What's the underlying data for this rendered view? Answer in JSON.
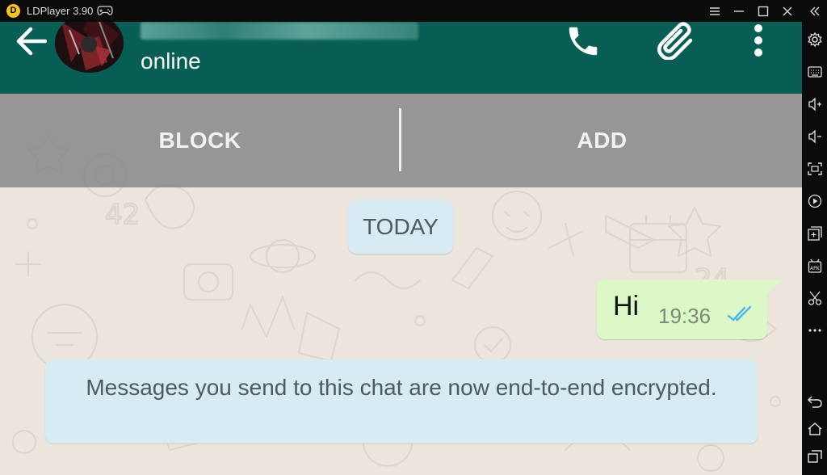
{
  "window": {
    "title": "LDPlayer 3.90",
    "logo_letter": "D"
  },
  "titlebar_buttons": [
    "menu-icon",
    "minimize-icon",
    "maximize-icon",
    "close-icon",
    "collapse-sidebar-icon"
  ],
  "sidebar": [
    "settings-icon",
    "keyboard-icon",
    "volume-up-icon",
    "volume-down-icon",
    "fullscreen-icon",
    "record-icon",
    "add-window-icon",
    "apk-install-icon",
    "scissors-icon",
    "more-icon",
    "back-nav-icon",
    "home-nav-icon",
    "recent-apps-icon"
  ],
  "chat": {
    "contact_status": "online",
    "header_icons": [
      "back-arrow-icon",
      "phone-icon",
      "paperclip-icon",
      "kebab-menu-icon"
    ],
    "actions": {
      "block_label": "BLOCK",
      "add_label": "ADD"
    },
    "date_chip": "TODAY",
    "messages": [
      {
        "text": "Hi",
        "time": "19:36",
        "status_icon": "double-check-icon"
      }
    ],
    "system_notice": "Messages you send to this chat are now end-to-end encrypted."
  },
  "colors": {
    "app_bar": "#075e54",
    "chat_background": "#ece5dd",
    "outgoing_bubble": "#dcf8c6",
    "system_bubble": "#d7ebf3",
    "read_ticks": "#4fb6ec"
  }
}
